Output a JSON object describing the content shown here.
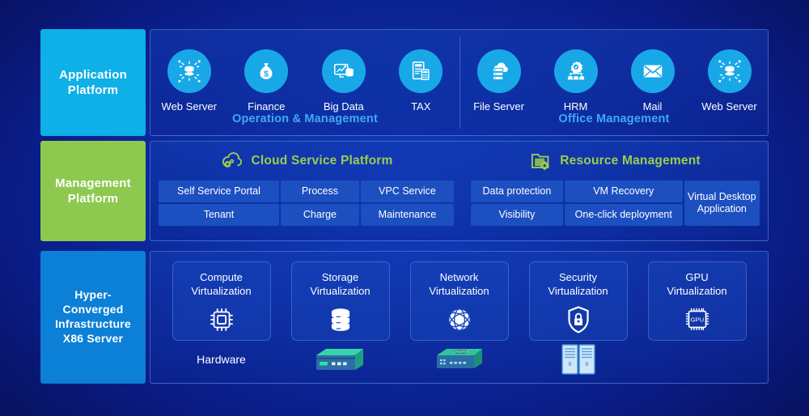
{
  "diagram": {
    "title": "Hyper-Converged Infrastructure Platform Architecture",
    "colors": {
      "application_band": "#0FAFE8",
      "management_band": "#8CC94E",
      "infrastructure_band": "#0C7FD6",
      "group_title": "#3FA9F5",
      "section_title_green": "#9ACD4E",
      "icon_circle": "#18A8E8",
      "chip": "#1C4FC0",
      "background": "#0D2FA6"
    }
  },
  "layers": {
    "application": {
      "band_label": "Application\nPlatform",
      "band_label_line1": "Application",
      "band_label_line2": "Platform",
      "groups": [
        {
          "title": "Operation & Management",
          "items": [
            {
              "label": "Web Server",
              "icon": "web-server-icon"
            },
            {
              "label": "Finance",
              "icon": "money-bag-icon"
            },
            {
              "label": "Big Data",
              "icon": "big-data-icon"
            },
            {
              "label": "TAX",
              "icon": "tax-document-icon"
            }
          ]
        },
        {
          "title": "Office Management",
          "items": [
            {
              "label": "File Server",
              "icon": "file-server-cloud-icon"
            },
            {
              "label": "HRM",
              "icon": "hrm-org-gear-icon"
            },
            {
              "label": "Mail",
              "icon": "mail-envelope-icon"
            },
            {
              "label": "Web Server",
              "icon": "web-server-icon"
            }
          ]
        }
      ]
    },
    "management": {
      "band_label_line1": "Management",
      "band_label_line2": "Platform",
      "sections": [
        {
          "title": "Cloud Service Platform",
          "icon": "cloud-gear-icon",
          "chips": [
            "Self Service Portal",
            "Process",
            "VPC Service",
            "Tenant",
            "Charge",
            "Maintenance"
          ]
        },
        {
          "title": "Resource Management",
          "icon": "folder-gear-icon",
          "chips": [
            "Data protection",
            "VM Recovery",
            "Virtual Desktop Application",
            "Visibility",
            "One-click deployment"
          ]
        }
      ]
    },
    "infrastructure": {
      "band_label_line1": "Hyper-",
      "band_label_line2": "Converged",
      "band_label_line3": "Infrastructure",
      "band_label_line4": "X86 Server",
      "cards": [
        {
          "line1": "Compute",
          "line2": "Virtualization",
          "icon": "cpu-chip-icon"
        },
        {
          "line1": "Storage",
          "line2": "Virtualization",
          "icon": "disk-stack-icon"
        },
        {
          "line1": "Network",
          "line2": "Virtualization",
          "icon": "globe-network-icon"
        },
        {
          "line1": "Security",
          "line2": "Virtualization",
          "icon": "shield-lock-icon"
        },
        {
          "line1": "GPU",
          "line2": "Virtualization",
          "icon": "gpu-chip-icon"
        }
      ],
      "hardware_row": [
        {
          "label": "Hardware",
          "icon": ""
        },
        {
          "label": "",
          "icon": "storage-array-icon"
        },
        {
          "label": "",
          "icon": "network-switch-icon"
        },
        {
          "label": "",
          "icon": "server-rack-icon"
        },
        {
          "label": "",
          "icon": ""
        }
      ],
      "gpu_chip_text": "GPU"
    }
  }
}
